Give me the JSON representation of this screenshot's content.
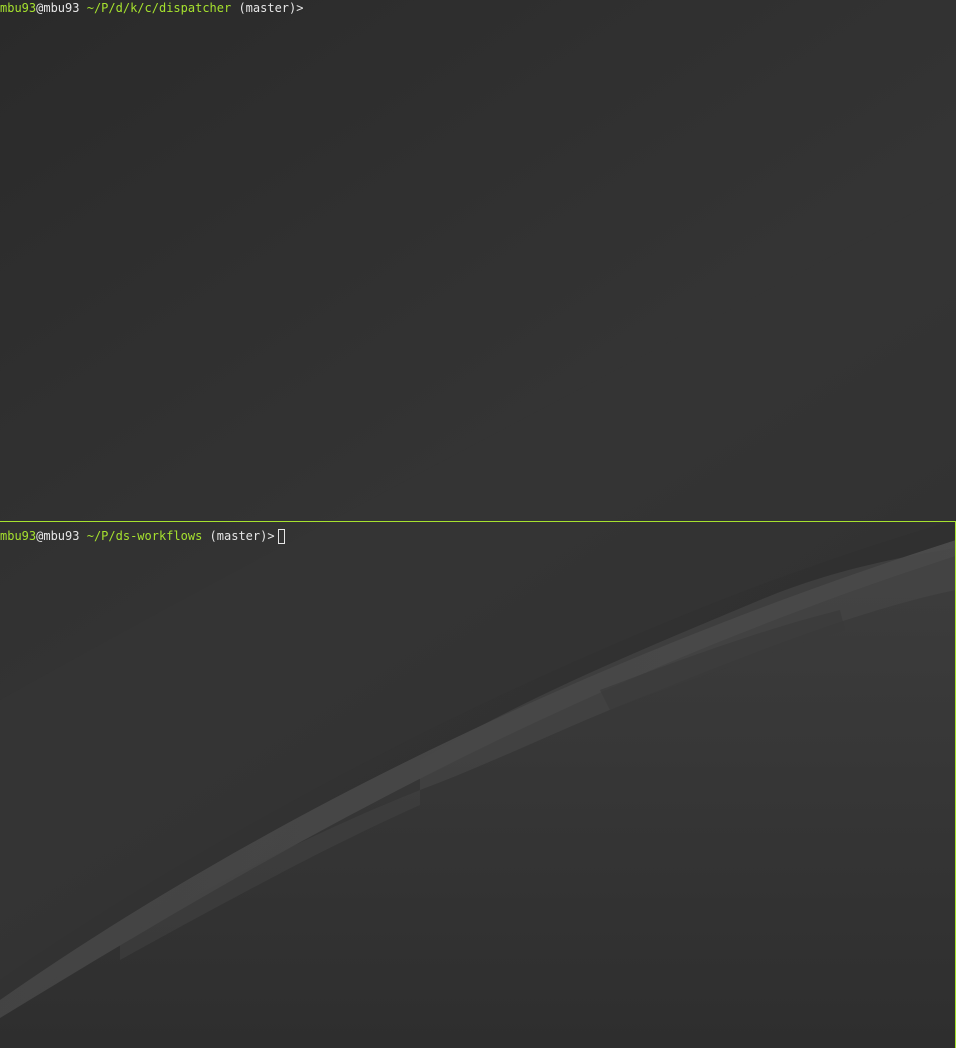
{
  "terminal": {
    "accent_color": "#a6e22e",
    "text_color": "#e6e6e6",
    "background": "dark earth-horizon wallpaper",
    "panes": [
      {
        "user": "mbu93",
        "at": "@",
        "host": "mbu93",
        "path": "~/P/d/k/c/dispatcher",
        "branch": "(master)",
        "symbol": ">"
      },
      {
        "user": "mbu93",
        "at": "@",
        "host": "mbu93",
        "path": "~/P/ds-workflows",
        "branch": "(master)",
        "symbol": ">",
        "active": true
      }
    ]
  }
}
